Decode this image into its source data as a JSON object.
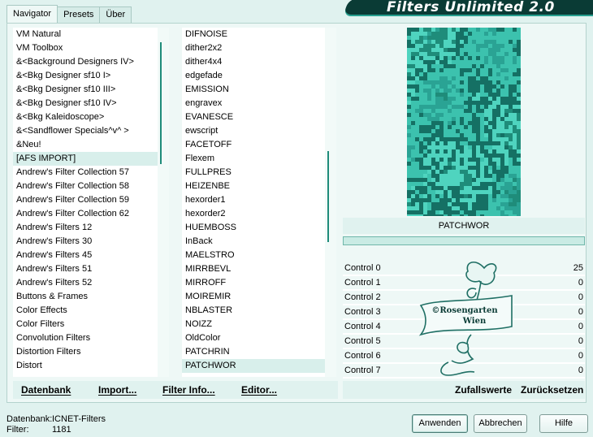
{
  "header": {
    "title": "Filters Unlimited 2.0",
    "tabs": [
      "Navigator",
      "Presets",
      "Über"
    ]
  },
  "categories": [
    "VM Natural",
    "VM Toolbox",
    "&<Background Designers IV>",
    "&<Bkg Designer sf10 I>",
    "&<Bkg Designer sf10 III>",
    "&<Bkg Designer sf10 IV>",
    "&<Bkg Kaleidoscope>",
    "&<Sandflower Specials^v^ >",
    "&Neu!",
    "[AFS IMPORT]",
    "Andrew's Filter Collection 57",
    "Andrew's Filter Collection 58",
    "Andrew's Filter Collection 59",
    "Andrew's Filter Collection 62",
    "Andrew's Filters 12",
    "Andrew's Filters 30",
    "Andrew's Filters 45",
    "Andrew's Filters 51",
    "Andrew's Filters 52",
    "Buttons & Frames",
    "Color Effects",
    "Color Filters",
    "Convolution Filters",
    "Distortion Filters",
    "Distort"
  ],
  "selected_category": "[AFS IMPORT]",
  "filters": [
    "DIFNOISE",
    "dither2x2",
    "dither4x4",
    "edgefade",
    "EMISSION",
    "engravex",
    "EVANESCE",
    "ewscript",
    "FACETOFF",
    "Flexem",
    "FULLPRES",
    "HEIZENBE",
    "hexorder1",
    "hexorder2",
    "HUEMBOSS",
    "InBack",
    "MAELSTRO",
    "MIRRBEVL",
    "MIRROFF",
    "MOIREMIR",
    "NBLASTER",
    "NOIZZ",
    "OldColor",
    "PATCHRIN",
    "PATCHWOR"
  ],
  "selected_filter": "PATCHWOR",
  "preview": {
    "filter_name": "PATCHWOR",
    "colors": [
      "#1f8c7a",
      "#2aa394",
      "#3cc2ae",
      "#157064",
      "#4fd4bf"
    ]
  },
  "controls": [
    {
      "label": "Control 0",
      "value": "25"
    },
    {
      "label": "Control 1",
      "value": "0"
    },
    {
      "label": "Control 2",
      "value": "0"
    },
    {
      "label": "Control 3",
      "value": "0"
    },
    {
      "label": "Control 4",
      "value": "0"
    },
    {
      "label": "Control 5",
      "value": "0"
    },
    {
      "label": "Control 6",
      "value": "0"
    },
    {
      "label": "Control 7",
      "value": "0"
    }
  ],
  "watermark": {
    "line1": "©Rosengarten",
    "line2": "Wien"
  },
  "links": {
    "datenbank": "Datenbank",
    "import": "Import...",
    "filter_info": "Filter Info...",
    "editor": "Editor...",
    "zufallswerte": "Zufallswerte",
    "zuruecksetzen": "Zurücksetzen"
  },
  "status": {
    "db_label": "Datenbank:",
    "db_value": "ICNET-Filters",
    "filter_label": "Filter:",
    "filter_value": "1181"
  },
  "buttons": {
    "apply": "Anwenden",
    "cancel": "Abbrechen",
    "help": "Hilfe"
  },
  "colors": {
    "accent": "#1f8c7a",
    "background": "#e0f2ef",
    "banner": "#0a3b35"
  }
}
